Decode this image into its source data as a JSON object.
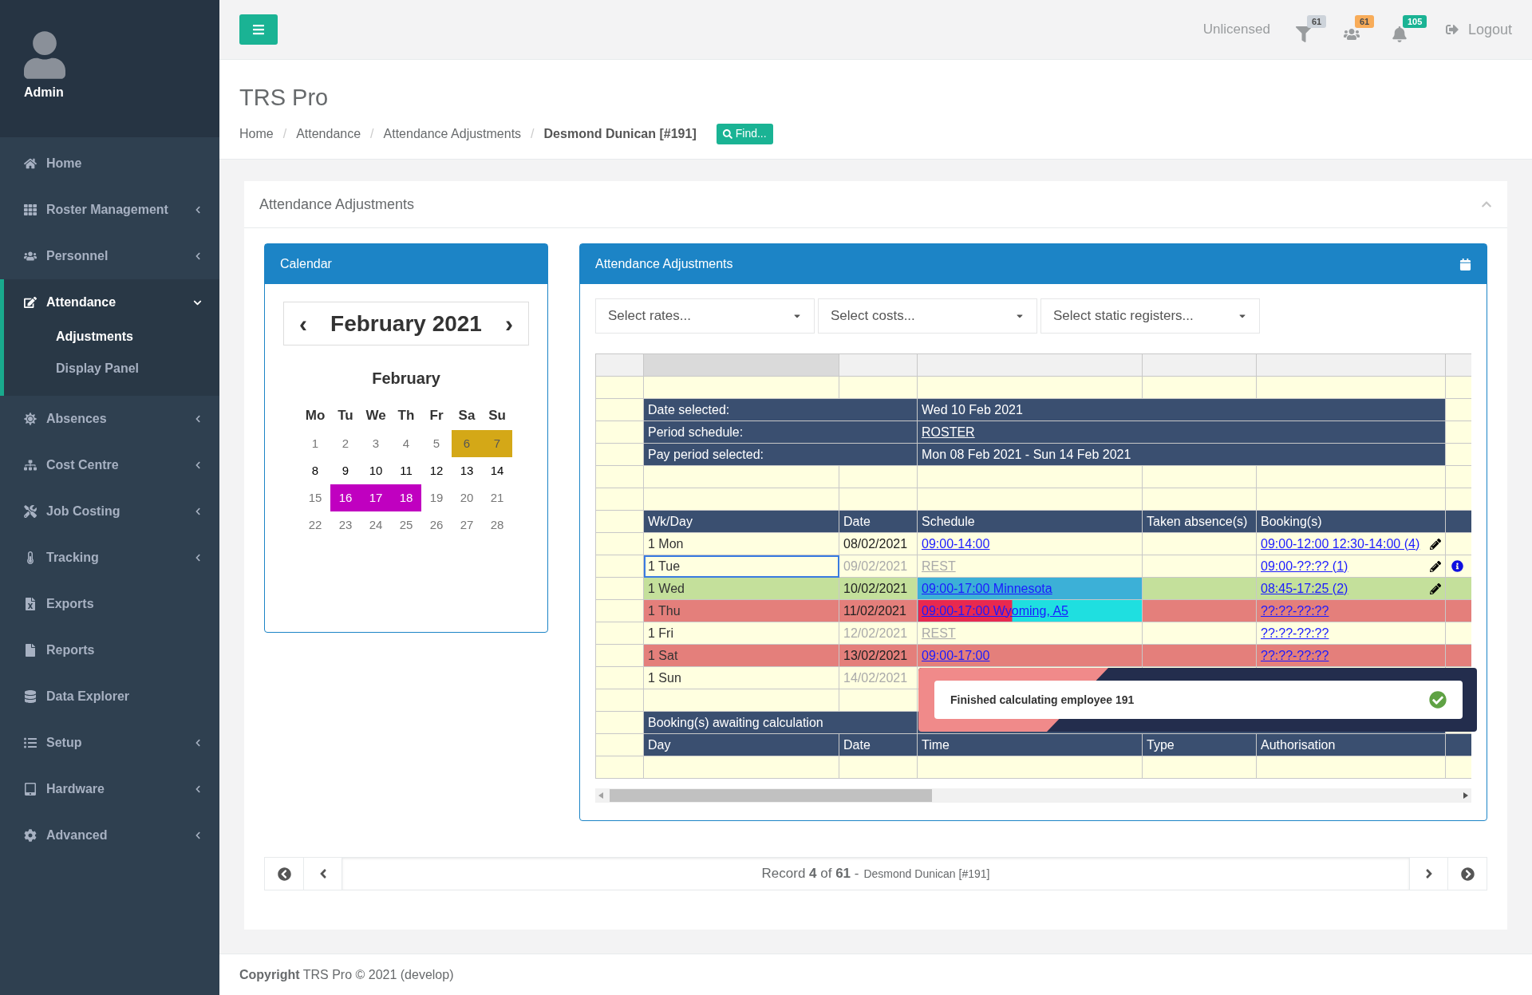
{
  "sidebar": {
    "user": "Admin",
    "items": [
      {
        "label": "Home",
        "submenu": false,
        "selected": false
      },
      {
        "label": "Roster Management",
        "submenu": true,
        "expanded": false,
        "selected": false
      },
      {
        "label": "Personnel",
        "submenu": true,
        "expanded": false,
        "selected": false
      },
      {
        "label": "Attendance",
        "submenu": true,
        "expanded": true,
        "selected": true,
        "children": [
          {
            "label": "Adjustments",
            "selected": true
          },
          {
            "label": "Display Panel",
            "selected": false
          }
        ]
      },
      {
        "label": "Absences",
        "submenu": true,
        "expanded": false,
        "selected": false
      },
      {
        "label": "Cost Centre",
        "submenu": true,
        "expanded": false,
        "selected": false
      },
      {
        "label": "Job Costing",
        "submenu": true,
        "expanded": false,
        "selected": false
      },
      {
        "label": "Tracking",
        "submenu": true,
        "expanded": false,
        "selected": false
      },
      {
        "label": "Exports",
        "submenu": false,
        "selected": false
      },
      {
        "label": "Reports",
        "submenu": false,
        "selected": false
      },
      {
        "label": "Data Explorer",
        "submenu": false,
        "selected": false
      },
      {
        "label": "Setup",
        "submenu": true,
        "expanded": false,
        "selected": false
      },
      {
        "label": "Hardware",
        "submenu": true,
        "expanded": false,
        "selected": false
      },
      {
        "label": "Advanced",
        "submenu": true,
        "expanded": false,
        "selected": false
      }
    ]
  },
  "topbar": {
    "license": "Unlicensed",
    "badges": [
      {
        "count": "61",
        "color": "#cdd3da"
      },
      {
        "count": "61",
        "color": "#f8ac59"
      },
      {
        "count": "105",
        "color": "#1ab394"
      }
    ],
    "logout": "Logout"
  },
  "page": {
    "title": "TRS Pro",
    "separator": "/",
    "breadcrumb": [
      {
        "label": "Home",
        "current": false
      },
      {
        "label": "Attendance",
        "current": false
      },
      {
        "label": "Attendance Adjustments",
        "current": false
      },
      {
        "label": "Desmond Dunican [#191]",
        "current": true
      }
    ],
    "find": "Find..."
  },
  "panel": {
    "title": "Attendance Adjustments"
  },
  "calendar": {
    "title": "Calendar",
    "prev": "‹",
    "next": "›",
    "heading": "February 2021",
    "month": "February",
    "weekdays": [
      "Mo",
      "Tu",
      "We",
      "Th",
      "Fr",
      "Sa",
      "Su"
    ],
    "weeks": [
      [
        {
          "day": "1",
          "muted": true
        },
        {
          "day": "2",
          "muted": true
        },
        {
          "day": "3",
          "muted": true
        },
        {
          "day": "4",
          "muted": true
        },
        {
          "day": "5",
          "muted": true
        },
        {
          "day": "6",
          "muted": true,
          "color": "#d4a817"
        },
        {
          "day": "7",
          "muted": true,
          "color": "#d4a817"
        }
      ],
      [
        {
          "day": "8",
          "muted": false
        },
        {
          "day": "9",
          "muted": false
        },
        {
          "day": "10",
          "muted": false
        },
        {
          "day": "11",
          "muted": false
        },
        {
          "day": "12",
          "muted": false
        },
        {
          "day": "13",
          "muted": false
        },
        {
          "day": "14",
          "muted": false
        }
      ],
      [
        {
          "day": "15",
          "muted": true
        },
        {
          "day": "16",
          "muted": true,
          "color": "#c000c0"
        },
        {
          "day": "17",
          "muted": true,
          "color": "#c000c0"
        },
        {
          "day": "18",
          "muted": true,
          "color": "#c000c0"
        },
        {
          "day": "19",
          "muted": true
        },
        {
          "day": "20",
          "muted": true
        },
        {
          "day": "21",
          "muted": true
        }
      ],
      [
        {
          "day": "22",
          "muted": true
        },
        {
          "day": "23",
          "muted": true
        },
        {
          "day": "24",
          "muted": true
        },
        {
          "day": "25",
          "muted": true
        },
        {
          "day": "26",
          "muted": true
        },
        {
          "day": "27",
          "muted": true
        },
        {
          "day": "28",
          "muted": true
        }
      ]
    ]
  },
  "adjustments": {
    "title": "Attendance Adjustments",
    "filters": [
      {
        "placeholder": "Select rates..."
      },
      {
        "placeholder": "Select costs..."
      },
      {
        "placeholder": "Select static registers..."
      }
    ],
    "info": [
      {
        "label": "Date selected:",
        "value": "Wed 10 Feb 2021",
        "link": false
      },
      {
        "label": "Period schedule:",
        "value": "ROSTER",
        "link": true
      },
      {
        "label": "Pay period selected:",
        "value": "Mon 08 Feb 2021 - Sun 14 Feb 2021",
        "link": false
      }
    ],
    "day_columns": [
      "Wk/Day",
      "Date",
      "Schedule",
      "Taken absence(s)",
      "Booking(s)"
    ],
    "days": [
      {
        "wk_day": "1 Mon",
        "date": "08/02/2021",
        "schedule": "09:00-14:00",
        "booking": "09:00-12:00 12:30-14:00 (4)",
        "off_day": false,
        "selected": false,
        "editable": true,
        "info": false,
        "color": "#ffffe0"
      },
      {
        "wk_day": "1 Tue",
        "date": "09/02/2021",
        "schedule": "REST",
        "booking": "09:00-??:?? (1)",
        "off_day": true,
        "selected": true,
        "editable": true,
        "info": true,
        "color": "#ffffe0"
      },
      {
        "wk_day": "1 Wed",
        "date": "10/02/2021",
        "schedule": "09:00-17:00 Minnesota",
        "schedule_fill": [
          {
            "color": "#3cb0d7"
          }
        ],
        "booking": "08:45-17:25 (2)",
        "off_day": false,
        "selected": false,
        "editable": true,
        "info": false,
        "color": "#c4e09b"
      },
      {
        "wk_day": "1 Thu",
        "date": "11/02/2021",
        "schedule": "09:00-17:00 Wyoming, A5",
        "schedule_fill": [
          {
            "color": "#e8294f"
          },
          {
            "color": "#1fdfe0"
          }
        ],
        "booking": "??:??-??:??",
        "off_day": false,
        "selected": false,
        "editable": false,
        "info": false,
        "color": "#e47f7b"
      },
      {
        "wk_day": "1 Fri",
        "date": "12/02/2021",
        "schedule": "REST",
        "booking": "??:??-??:??",
        "off_day": true,
        "selected": false,
        "editable": false,
        "info": false,
        "color": "#ffffe0"
      },
      {
        "wk_day": "1 Sat",
        "date": "13/02/2021",
        "schedule": "09:00-17:00",
        "booking": "??:??-??:??",
        "off_day": false,
        "selected": false,
        "editable": false,
        "info": false,
        "color": "#e47f7b"
      },
      {
        "wk_day": "1 Sun",
        "date": "14/02/2021",
        "off_day": true,
        "selected": false,
        "editable": false,
        "info": false,
        "color": "#ffffe0"
      }
    ],
    "pending_title": "Booking(s) awaiting calculation",
    "pending_columns": [
      "Day",
      "Date",
      "Time",
      "Type",
      "Authorisation"
    ]
  },
  "toast": {
    "message": "Finished calculating employee 191"
  },
  "record_nav": {
    "summary": "Record **4** of **61** -",
    "employee": "Desmond Dunican [#191]"
  },
  "footer": "**Copyright** TRS Pro © 2021 (develop)"
}
